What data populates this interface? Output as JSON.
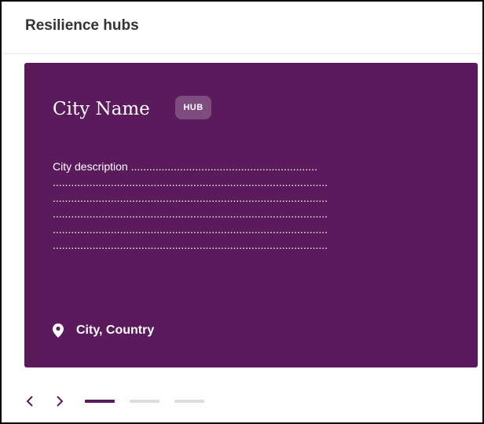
{
  "header": {
    "title": "Resilience hubs"
  },
  "card": {
    "city_name": "City Name",
    "badge": "HUB",
    "description_lines": [
      "City description .............................................................",
      "..........................................................................................",
      "..........................................................................................",
      "..........................................................................................",
      "..........................................................................................",
      ".........................................................................................."
    ],
    "location": "City, Country",
    "background_color": "#5a1a5c"
  },
  "carousel": {
    "prev_icon": "chevron-left-icon",
    "next_icon": "chevron-right-icon",
    "pages": 3,
    "active_page": 1,
    "accent_color": "#5a1a5c"
  }
}
